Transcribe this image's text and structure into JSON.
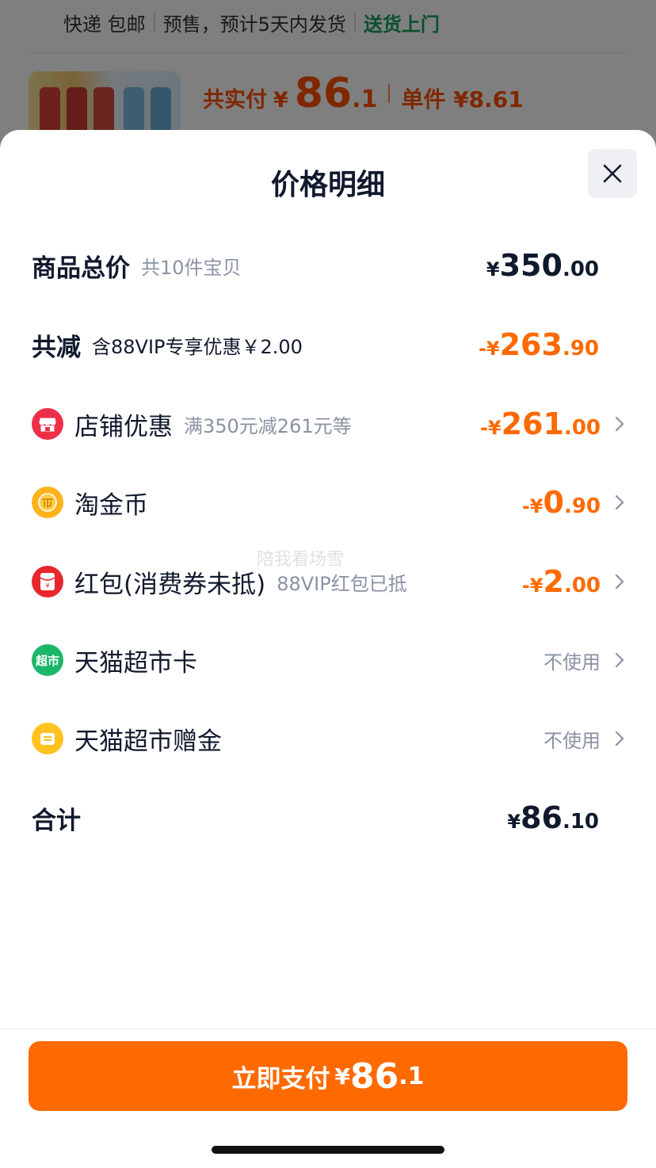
{
  "background": {
    "delivery": {
      "item1": "快递 包邮",
      "item2": "预售，预计5天内发货",
      "item3": "送货上门"
    },
    "price": {
      "label": "共实付",
      "currency": "¥",
      "integer": "86",
      "decimal": ".1",
      "unit_label": "单件 ¥8.61"
    }
  },
  "sheet": {
    "title": "价格明细",
    "watermark": "陪我看场雪",
    "rows": {
      "total": {
        "label": "商品总价",
        "sub": "共10件宝贝",
        "currency": "¥",
        "integer": "350",
        "decimal": ".00"
      },
      "reduction": {
        "label": "共减",
        "sub": "含88VIP专享优惠￥2.00",
        "currency": "-¥",
        "integer": "263",
        "decimal": ".90"
      },
      "store": {
        "label": "店铺优惠",
        "sub": "满350元减261元等",
        "currency": "-¥",
        "integer": "261",
        "decimal": ".00",
        "icon": "store-icon"
      },
      "coin": {
        "label": "淘金币",
        "currency": "-¥",
        "integer": "0",
        "decimal": ".90",
        "icon": "coin-icon"
      },
      "redpacket": {
        "label": "红包(消费券未抵)",
        "sub": "88VIP红包已抵",
        "currency": "-¥",
        "integer": "2",
        "decimal": ".00",
        "icon": "red-packet-icon"
      },
      "card": {
        "label": "天猫超市卡",
        "value": "不使用",
        "icon": "supermarket-card-icon",
        "icon_text": "超市"
      },
      "gift": {
        "label": "天猫超市赠金",
        "value": "不使用",
        "icon": "gift-money-icon"
      },
      "sum": {
        "label": "合计",
        "currency": "¥",
        "integer": "86",
        "decimal": ".10"
      }
    }
  },
  "pay_button": {
    "label": "立即支付",
    "currency": "¥",
    "integer": "86",
    "decimal": ".1"
  },
  "colors": {
    "accent": "#ff6a00",
    "text": "#11192d",
    "muted": "#8a92a3",
    "green": "#14a05a"
  }
}
